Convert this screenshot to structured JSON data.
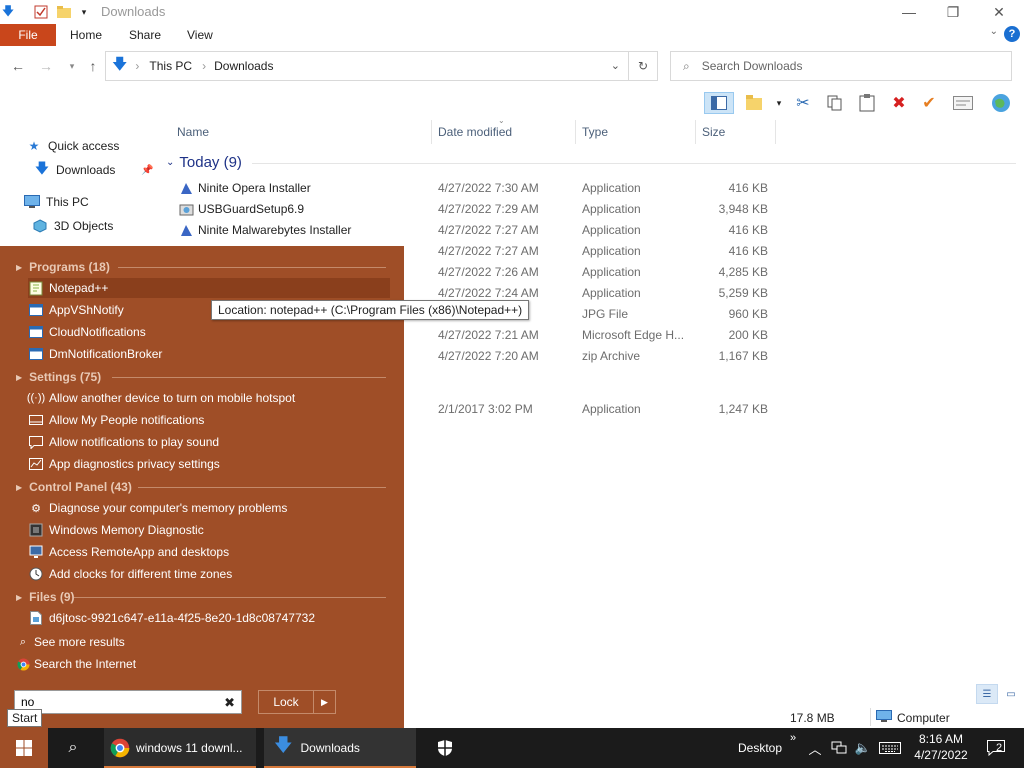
{
  "window": {
    "title": "Downloads",
    "minimize_label": "—",
    "maximize_label": "❐",
    "close_label": "✕"
  },
  "ribbon": {
    "tabs": [
      "File",
      "Home",
      "Share",
      "View"
    ],
    "help_label": "?",
    "collapse_label": "⌄"
  },
  "address": {
    "crumbs": [
      "This PC",
      "Downloads"
    ],
    "separator": "›"
  },
  "search": {
    "placeholder": "Search Downloads"
  },
  "navpane": {
    "items": [
      "Quick access",
      "Downloads",
      "This PC",
      "3D Objects"
    ]
  },
  "columns": {
    "name": "Name",
    "date": "Date modified",
    "type": "Type",
    "size": "Size"
  },
  "group": {
    "label": "Today (9)"
  },
  "files": [
    {
      "name": "Ninite Opera Installer",
      "date": "4/27/2022 7:30 AM",
      "type": "Application",
      "size": "416 KB",
      "icon": "ninite-icon"
    },
    {
      "name": "USBGuardSetup6.9",
      "date": "4/27/2022 7:29 AM",
      "type": "Application",
      "size": "3,948 KB",
      "icon": "installer-icon"
    },
    {
      "name": "Ninite Malwarebytes Installer",
      "date": "4/27/2022 7:27 AM",
      "type": "Application",
      "size": "416 KB",
      "icon": "ninite-icon"
    },
    {
      "name": "",
      "date": "4/27/2022 7:27 AM",
      "type": "Application",
      "size": "416 KB",
      "icon": ""
    },
    {
      "name": "",
      "date": "4/27/2022 7:26 AM",
      "type": "Application",
      "size": "4,285 KB",
      "icon": ""
    },
    {
      "name": "",
      "date": "4/27/2022 7:24 AM",
      "type": "Application",
      "size": "5,259 KB",
      "icon": ""
    },
    {
      "name": "",
      "date": "",
      "type": "JPG File",
      "size": "960 KB",
      "icon": ""
    },
    {
      "name": "",
      "date": "4/27/2022 7:21 AM",
      "type": "Microsoft Edge H...",
      "size": "200 KB",
      "icon": ""
    },
    {
      "name": "",
      "date": "4/27/2022 7:20 AM",
      "type": "zip Archive",
      "size": "1,167 KB",
      "icon": ""
    },
    {
      "name": "",
      "date": "2/1/2017 3:02 PM",
      "type": "Application",
      "size": "1,247 KB",
      "icon": ""
    }
  ],
  "status": {
    "size": "17.8 MB",
    "zone": "Computer"
  },
  "startmenu": {
    "categories": {
      "programs": "Programs (18)",
      "settings": "Settings (75)",
      "control_panel": "Control Panel (43)",
      "files": "Files (9)"
    },
    "programs": [
      "Notepad++",
      "AppVShNotify",
      "CloudNotifications",
      "DmNotificationBroker"
    ],
    "settings": [
      "Allow another device to turn on mobile hotspot",
      "Allow My People notifications",
      "Allow notifications to play sound",
      "App diagnostics privacy settings"
    ],
    "control_panel": [
      "Diagnose your computer's memory problems",
      "Windows Memory Diagnostic",
      "Access RemoteApp and desktops",
      "Add clocks for different time zones"
    ],
    "files": [
      "d6jtosc-9921c647-e11a-4f25-8e20-1d8c08747732"
    ],
    "see_more": "See more results",
    "search_internet": "Search the Internet",
    "search_value": "no",
    "lock_label": "Lock",
    "tooltip": "Location: notepad++ (C:\\Program Files (x86)\\Notepad++)",
    "start_tooltip": "Start"
  },
  "taskbar": {
    "apps": [
      "windows 11 downl...",
      "Downloads"
    ],
    "desktop_label": "Desktop",
    "time": "8:16 AM",
    "date": "4/27/2022",
    "notification_count": "2"
  },
  "colors": {
    "accent": "#9f4e27",
    "file_tab": "#c9461b",
    "taskbar": "#1b1b1b",
    "group_header": "#1e3287"
  }
}
